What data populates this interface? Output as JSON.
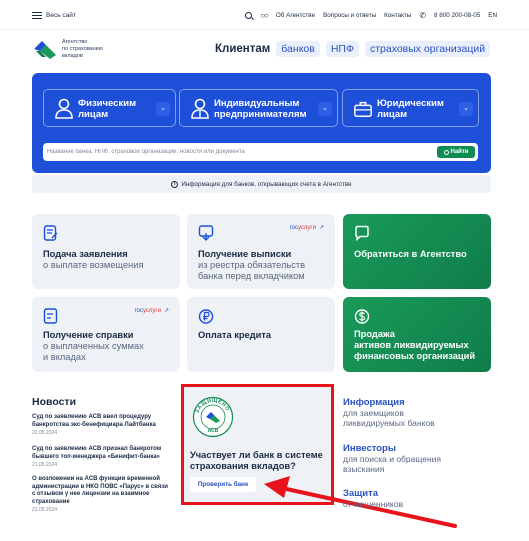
{
  "topbar": {
    "menu_label": "Весь сайт",
    "links": [
      "Об Агентстве",
      "Вопросы и ответы",
      "Контакты"
    ],
    "phone": "8 800 200-08-05",
    "lang": "EN"
  },
  "logo": {
    "line1": "Агентство",
    "line2": "по страхованию",
    "line3": "вкладов"
  },
  "nav": {
    "label": "Клиентам",
    "chips": [
      "банков",
      "НПФ",
      "страховых организаций"
    ]
  },
  "hero": {
    "categories": [
      {
        "line1": "Физическим",
        "line2": "лицам"
      },
      {
        "line1": "Индивидуальным",
        "line2": "предпринимателям"
      },
      {
        "line1": "Юридическим",
        "line2": "лицам"
      }
    ],
    "search_placeholder": "Название банка, НПФ, страховой организации, новости или документа",
    "search_button": "Найти"
  },
  "info_bar": "Информация для банков, открывающих счета в Агентстве",
  "cards": [
    {
      "title": "Подача заявления",
      "sub1": "о выплате возмещения",
      "sub2": ""
    },
    {
      "title": "Получение выписки",
      "sub1": "из реестра обязательств",
      "sub2": "банка перед вкладчиком"
    },
    {
      "title": "Обратиться в Агентство",
      "sub1": "",
      "sub2": ""
    },
    {
      "title": "Получение справки",
      "sub1": "о выплаченных суммах",
      "sub2": "и вкладах"
    },
    {
      "title": "Оплата кредита",
      "sub1": "",
      "sub2": ""
    },
    {
      "title": "Продажа",
      "sub1": "активов ликвидируемых",
      "sub2": "финансовых организаций"
    }
  ],
  "gosuslugi": {
    "part1": "гос",
    "part2": "услуги"
  },
  "news": {
    "heading": "Новости",
    "items": [
      {
        "title": "Суд по заявлению АСВ ввел процедуру банкротства экс-бенефициара Лайтбанка",
        "date": "22.05.2024"
      },
      {
        "title": "Суд по заявлению АСВ признал банкротом бывшего топ-менеджера «Бенифит-банка»",
        "date": "21.05.2024"
      },
      {
        "title": "О возложении на АСВ функции временной администрации в НКО ПОВС «Парус» в связи с отзывом у нее лицензии на взаимное страхование",
        "date": "21.05.2024"
      }
    ]
  },
  "promo": {
    "stamp_top": "ЗАЩИЩЕНО",
    "stamp_bottom": "АСВ",
    "title_line1": "Участвует ли банк в системе",
    "title_line2": "страхования вкладов?",
    "button": "Проверить банк"
  },
  "right_links": [
    {
      "title": "Информация",
      "sub1": "для заемщиков",
      "sub2": "ликвидируемых банков"
    },
    {
      "title": "Инвесторы",
      "sub1": "для поиска и обращения",
      "sub2": "взыскания"
    },
    {
      "title": "Защита",
      "sub1": "от мошенников",
      "sub2": ""
    }
  ],
  "colors": {
    "brand_blue": "#1d4fd8",
    "link_blue": "#2a52be",
    "green": "#0f8c52",
    "highlight_red": "#e8141b"
  }
}
